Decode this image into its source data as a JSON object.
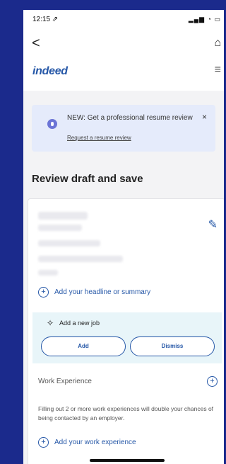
{
  "status": {
    "time": "12:15 ⇗",
    "icons": "▂▄▆ ◔ ▭"
  },
  "nav": {
    "back": "<",
    "home": "⌂"
  },
  "brand": {
    "logo": "indeed",
    "menu": "≡"
  },
  "banner": {
    "text": "NEW: Get a professional resume review",
    "link": "Request a resume review",
    "close": "×"
  },
  "page": {
    "title": "Review draft and save"
  },
  "card": {
    "headline_action": "Add your headline or summary",
    "new_job": {
      "label": "Add a new job",
      "add": "Add",
      "dismiss": "Dismiss"
    },
    "work_section": "Work Experience",
    "note": "Filling out 2 or more work experiences will double your chances of being contacted by an employer.",
    "work_action": "Add your work experience"
  },
  "colors": {
    "brand_blue": "#2557a7",
    "background": "#1b2a8c"
  }
}
